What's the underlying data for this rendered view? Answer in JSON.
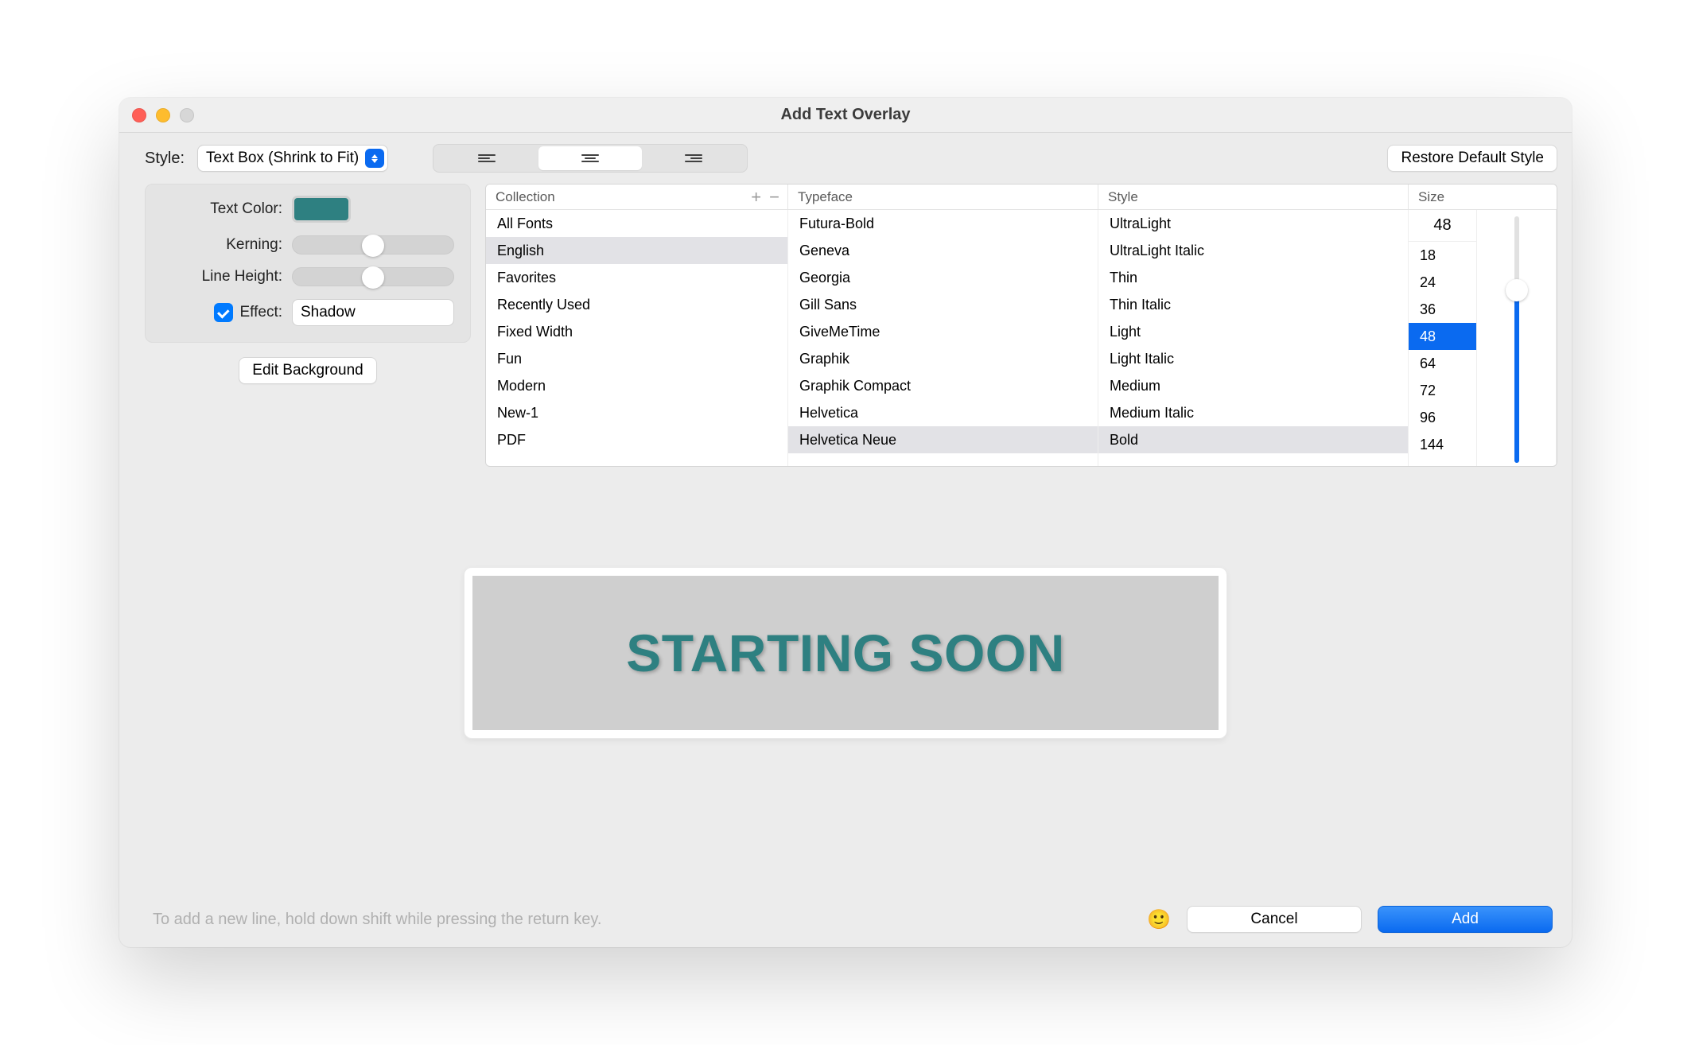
{
  "window": {
    "title": "Add Text Overlay"
  },
  "style_row": {
    "label": "Style:",
    "dropdown_value": "Text Box (Shrink to Fit)"
  },
  "restore_button": "Restore Default Style",
  "properties": {
    "text_color_label": "Text Color:",
    "text_color_value": "#2e8081",
    "kerning_label": "Kerning:",
    "line_height_label": "Line Height:",
    "effect_label": "Effect:",
    "effect_checked": true,
    "effect_value": "Shadow"
  },
  "edit_background_button": "Edit Background",
  "font_browser": {
    "headers": {
      "collection": "Collection",
      "typeface": "Typeface",
      "style": "Style",
      "size": "Size"
    },
    "collections": [
      "All Fonts",
      "English",
      "Favorites",
      "Recently Used",
      "Fixed Width",
      "Fun",
      "Modern",
      "New-1",
      "PDF"
    ],
    "collection_selected": "English",
    "typefaces": [
      "Futura-Bold",
      "Geneva",
      "Georgia",
      "Gill Sans",
      "GiveMeTime",
      "Graphik",
      "Graphik Compact",
      "Helvetica",
      "Helvetica Neue"
    ],
    "typeface_selected": "Helvetica Neue",
    "styles": [
      "UltraLight",
      "UltraLight Italic",
      "Thin",
      "Thin Italic",
      "Light",
      "Light Italic",
      "Medium",
      "Medium Italic",
      "Bold"
    ],
    "style_selected": "Bold",
    "size_input": "48",
    "sizes": [
      "18",
      "24",
      "36",
      "48",
      "64",
      "72",
      "96",
      "144"
    ],
    "size_selected": "48"
  },
  "preview_text": "STARTING SOON",
  "footer": {
    "hint": "To add a new line, hold down shift while pressing the return key.",
    "cancel": "Cancel",
    "add": "Add"
  }
}
